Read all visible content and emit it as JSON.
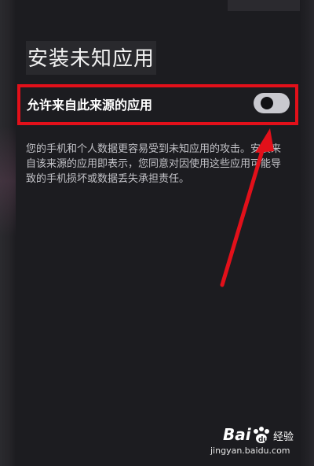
{
  "page": {
    "title": "安装未知应用"
  },
  "setting": {
    "label": "允许来自此来源的应用",
    "toggle_state": "off",
    "description": "您的手机和个人数据更容易受到未知应用的攻击。安装来自该来源的应用即表示，您同意对因使用这些应用可能导致的手机损坏或数据丢失承担责任。"
  },
  "annotation": {
    "box_color": "#e2101a",
    "arrow_color": "#e2101a"
  },
  "watermark": {
    "brand_left": "Bai",
    "brand_right": "经验",
    "url": "jingyan.baidu.com"
  },
  "colors": {
    "background": "#1c1c20",
    "accent_red": "#e2101a",
    "toggle_track": "#c9c9cf"
  }
}
